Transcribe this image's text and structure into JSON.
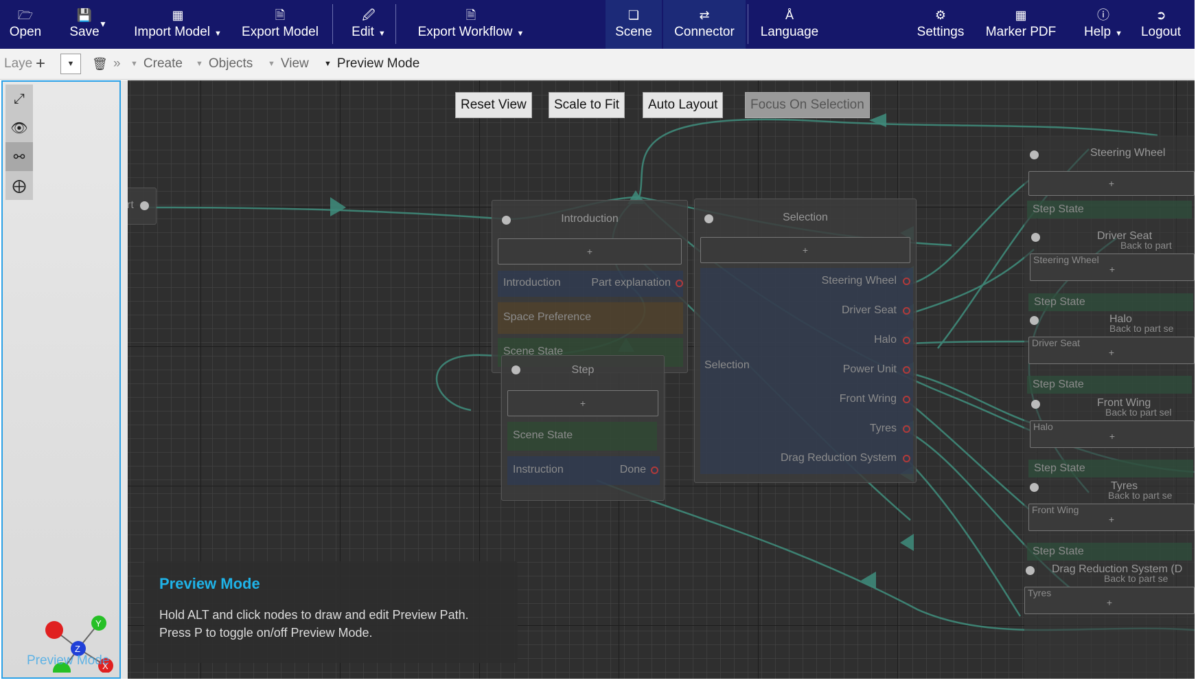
{
  "toolbar": {
    "open": "Open",
    "save": "Save",
    "import_model": "Import Model",
    "export_model": "Export Model",
    "edit": "Edit",
    "export_workflow": "Export Workflow",
    "scene": "Scene",
    "connector": "Connector",
    "language": "Language",
    "settings": "Settings",
    "marker_pdf": "Marker PDF",
    "help": "Help",
    "logout": "Logout"
  },
  "subbar": {
    "layer_label": "Laye",
    "add": "+",
    "more": "»",
    "menus": [
      "Create",
      "Objects",
      "View",
      "Preview Mode"
    ]
  },
  "left_tools": [
    "expand-icon",
    "eye-icon",
    "key-icon",
    "move-icon"
  ],
  "gizmo": {
    "y": "Y",
    "z": "Z",
    "x": "X",
    "overlay_text": "Preview Mode"
  },
  "canvas": {
    "buttons": {
      "reset": "Reset View",
      "scale": "Scale to Fit",
      "auto": "Auto Layout",
      "focus": "Focus On Selection"
    },
    "start_stub": "rt",
    "intro_node": {
      "title": "Introduction",
      "plus": "+",
      "rows": [
        {
          "left": "Introduction",
          "right": "Part explanation"
        },
        {
          "left": "Space Preference"
        },
        {
          "left": "Scene State"
        }
      ]
    },
    "step_node": {
      "title": "Step",
      "plus": "+",
      "rows": [
        {
          "left": "Scene State"
        },
        {
          "left": "Instruction",
          "right": "Done"
        }
      ]
    },
    "selection_node": {
      "title": "Selection",
      "plus": "+",
      "side_label": "Selection",
      "outputs": [
        "Steering Wheel",
        "Driver Seat",
        "Halo",
        "Power Unit",
        "Front Wring",
        "Tyres",
        "Drag Reduction System"
      ]
    },
    "right_column": {
      "step_state_label": "Step State",
      "nodes": [
        {
          "title": "Steering Wheel",
          "sub": "",
          "field": ""
        },
        {
          "title": "Driver Seat",
          "sub": "Back to part",
          "field": "Steering Wheel"
        },
        {
          "title": "Halo",
          "sub": "Back to part se",
          "field": "Driver Seat"
        },
        {
          "title": "Front Wing",
          "sub": "Back to part sel",
          "field": "Halo"
        },
        {
          "title": "Tyres",
          "sub": "Back to part se",
          "field": "Front Wing"
        },
        {
          "title": "Drag Reduction System (D",
          "sub": "Back to part se",
          "field": "Tyres"
        }
      ]
    },
    "hint": {
      "title": "Preview Mode",
      "line1": "Hold ALT and click nodes to draw and edit Preview Path.",
      "line2": "Press P to toggle on/off Preview Mode."
    }
  },
  "colors": {
    "toolbar_bg": "#15176a",
    "canvas_bg": "#2f2f2f",
    "accent": "#1fb3e8",
    "edge": "#3f8a7a",
    "panel_border": "#2aa0e6"
  }
}
